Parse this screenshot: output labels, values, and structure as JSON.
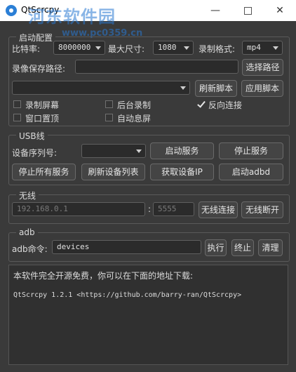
{
  "window": {
    "title": "QtScrcpy",
    "watermark": "河东软件园",
    "watermark_url": "www.pc0359.cn",
    "minimize": "—",
    "close": "✕"
  },
  "start_config": {
    "title": "启动配置",
    "bitrate_label": "比特率:",
    "bitrate_value": "8000000",
    "max_size_label": "最大尺寸:",
    "max_size_value": "1080",
    "format_label": "录制格式:",
    "format_value": "mp4",
    "save_path_label": "录像保存路径:",
    "save_path_value": "",
    "select_path_button": "选择路径",
    "script_value": "",
    "refresh_script_button": "刷新脚本",
    "apply_script_button": "应用脚本",
    "record_screen": "录制屏幕",
    "background_record": "后台录制",
    "reverse_connect": "反向连接",
    "window_on_top": "窗口置顶",
    "auto_screen_off": "自动息屏"
  },
  "usb": {
    "title": "USB线",
    "serial_label": "设备序列号:",
    "serial_value": "",
    "start_service": "启动服务",
    "stop_service": "停止服务",
    "stop_all": "停止所有服务",
    "refresh_devices": "刷新设备列表",
    "get_ip": "获取设备IP",
    "start_adbd": "启动adbd"
  },
  "wireless": {
    "title": "无线",
    "ip_placeholder": "192.168.0.1",
    "separator": ":",
    "port_placeholder": "5555",
    "connect": "无线连接",
    "disconnect": "无线断开"
  },
  "adb": {
    "title": "adb",
    "cmd_label": "adb命令:",
    "cmd_value": "devices",
    "execute": "执行",
    "terminate": "终止",
    "clear": "清理"
  },
  "log": {
    "line1": "本软件完全开源免费，你可以在下面的地址下载:",
    "line2": "QtScrcpy 1.2.1 <https://github.com/barry-ran/QtScrcpy>"
  }
}
